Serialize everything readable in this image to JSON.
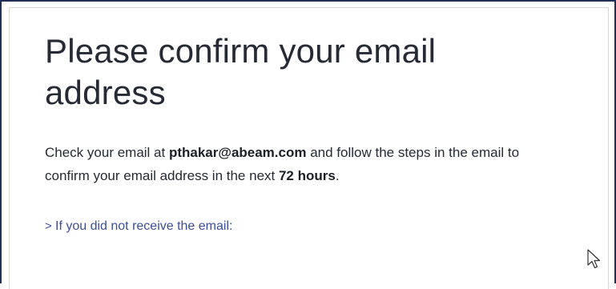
{
  "page": {
    "title": "Please confirm your email address",
    "message": {
      "part1": "Check your email at ",
      "email": "pthakar@abeam.com",
      "part2": " and follow the steps in the email to confirm your email address in the next ",
      "duration": "72 hours",
      "part3": "."
    },
    "expand_link": {
      "label": "If you did not receive the email:",
      "icon": "chevron-right-icon"
    }
  },
  "colors": {
    "frame_border": "#1f2f5a",
    "title_text": "#262a35",
    "link": "#3b4f9a"
  }
}
